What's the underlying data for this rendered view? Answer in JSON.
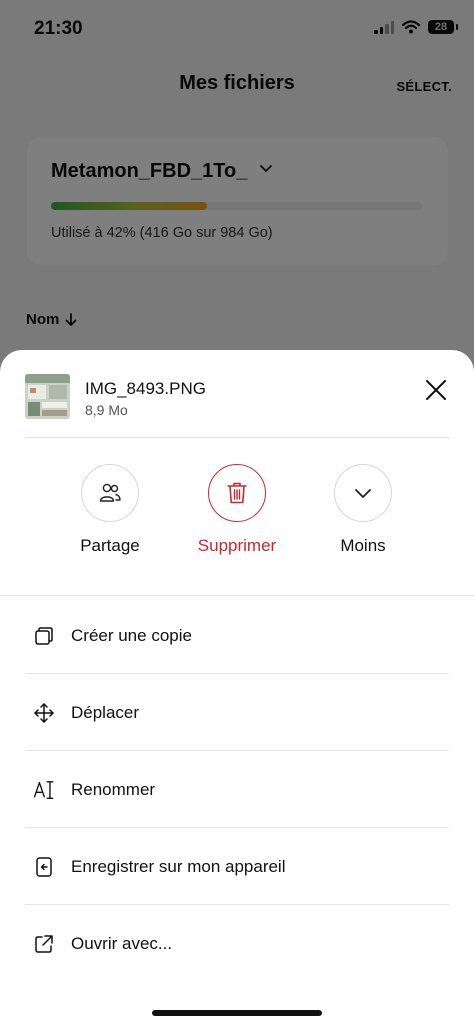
{
  "status_bar": {
    "time": "21:30",
    "battery": "28"
  },
  "header": {
    "title": "Mes fichiers",
    "select_label": "SÉLECT."
  },
  "storage": {
    "drive_name": "Metamon_FBD_1To_",
    "usage_text": "Utilisé à 42% (416 Go sur 984 Go)",
    "usage_fraction": 0.42
  },
  "sort": {
    "label": "Nom"
  },
  "sheet": {
    "file_name": "IMG_8493.PNG",
    "file_size": "8,9 Mo",
    "actions": [
      {
        "label": "Partage",
        "icon": "people-icon"
      },
      {
        "label": "Supprimer",
        "icon": "trash-icon"
      },
      {
        "label": "Moins",
        "icon": "chevron-down-icon"
      }
    ],
    "menu": [
      {
        "label": "Créer une copie",
        "icon": "copy-icon"
      },
      {
        "label": "Déplacer",
        "icon": "move-icon"
      },
      {
        "label": "Renommer",
        "icon": "rename-icon"
      },
      {
        "label": "Enregistrer sur mon appareil",
        "icon": "save-device-icon"
      },
      {
        "label": "Ouvrir avec...",
        "icon": "open-external-icon"
      }
    ]
  },
  "colors": {
    "danger": "#c8282e",
    "usage_start": "#3fae45",
    "usage_end": "#f0a328"
  }
}
